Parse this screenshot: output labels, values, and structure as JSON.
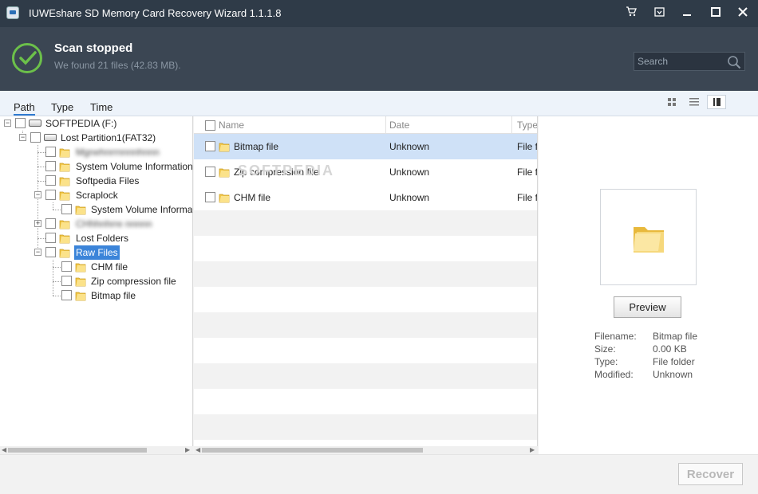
{
  "window": {
    "title": "IUWEshare SD Memory Card Recovery Wizard 1.1.1.8",
    "controls": {
      "cart": "🛒",
      "menu": "▾",
      "minimize": "▁",
      "close": "✕"
    }
  },
  "header": {
    "status_title": "Scan stopped",
    "status_subtitle": "We found 21 files (42.83 MB).",
    "search_placeholder": "Search"
  },
  "tabs": [
    "Path",
    "Type",
    "Time"
  ],
  "tree": {
    "root": "SOFTPEDIA (F:)",
    "partition": "Lost Partition1(FAT32)",
    "blurred_1": "Mgnehnrrnnnnhnnn",
    "system_volume": "System Volume Information",
    "softpedia_files": "Softpedia Files",
    "scraplock": "Scraplock",
    "scraplock_child": "System Volume Information",
    "blurred_2": "CHhhnhrre nnnnn",
    "lost_folders": "Lost Folders",
    "raw_files": "Raw Files",
    "raw_children": [
      "CHM file",
      "Zip compression file",
      "Bitmap file"
    ]
  },
  "list": {
    "columns": [
      "Name",
      "Date",
      "Type"
    ],
    "rows": [
      {
        "name": "Bitmap file",
        "date": "Unknown",
        "type": "File f"
      },
      {
        "name": "Zip compression file",
        "date": "Unknown",
        "type": "File f"
      },
      {
        "name": "CHM file",
        "date": "Unknown",
        "type": "File f"
      }
    ]
  },
  "preview": {
    "button": "Preview",
    "labels": {
      "filename": "Filename:",
      "size": "Size:",
      "type": "Type:",
      "modified": "Modified:"
    },
    "values": {
      "filename": "Bitmap file",
      "size": "0.00 KB",
      "type": "File folder",
      "modified": "Unknown"
    }
  },
  "footer": {
    "recover_label": "Recover"
  },
  "watermark": "SOFTPEDIA",
  "colors": {
    "header_bg": "#3b4653",
    "titlebar_bg": "#2f3b48",
    "accent": "#6cc04a",
    "selection": "#3b84d9"
  }
}
